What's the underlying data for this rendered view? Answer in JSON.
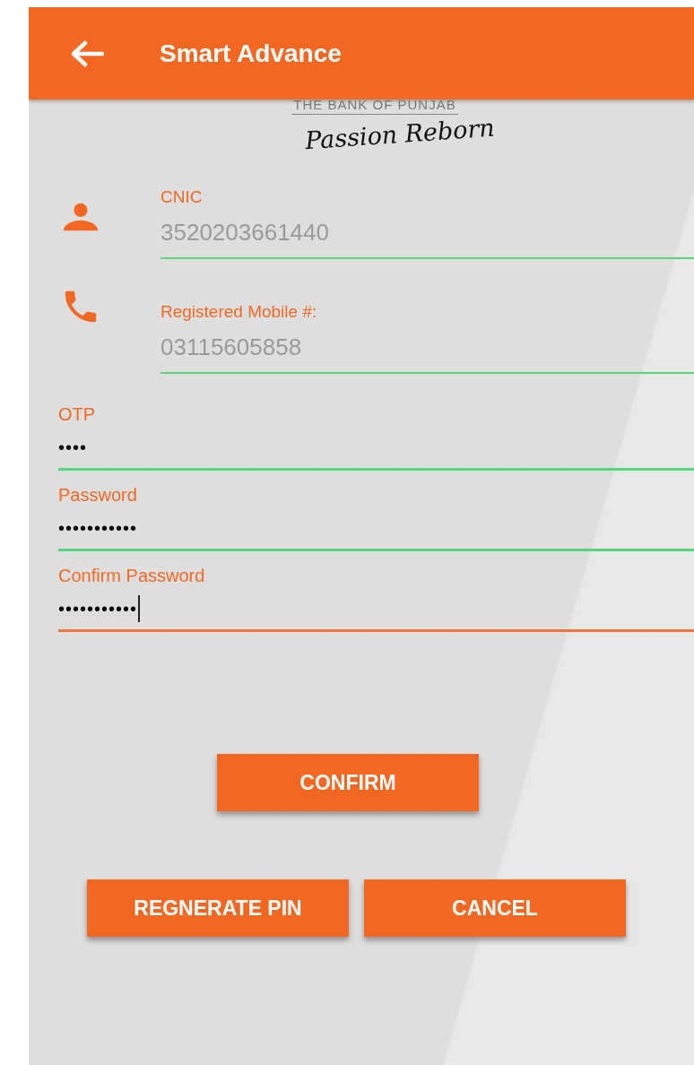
{
  "app_bar": {
    "title": "Smart Advance"
  },
  "logo": {
    "bank_name": "THE BANK OF PUNJAB",
    "tagline": "Passion Reborn"
  },
  "fields": [
    {
      "kind": "person",
      "label": "CNIC",
      "value": "3520203661440",
      "focused": false,
      "masked": false
    },
    {
      "kind": "phone",
      "label": "Registered Mobile #:",
      "value": "03115605858",
      "focused": false,
      "masked": false
    },
    {
      "kind": "plain",
      "label": "OTP",
      "value": "••••",
      "focused": false,
      "masked": true
    },
    {
      "kind": "plain",
      "label": "Password",
      "value": "•••••••••••",
      "focused": false,
      "masked": true
    },
    {
      "kind": "plain",
      "label": "Confirm Password",
      "value": "•••••••••••",
      "focused": true,
      "masked": true
    }
  ],
  "confirm_button": "CONFIRM",
  "bottom_buttons": [
    "REGNERATE PIN",
    "CANCEL"
  ]
}
